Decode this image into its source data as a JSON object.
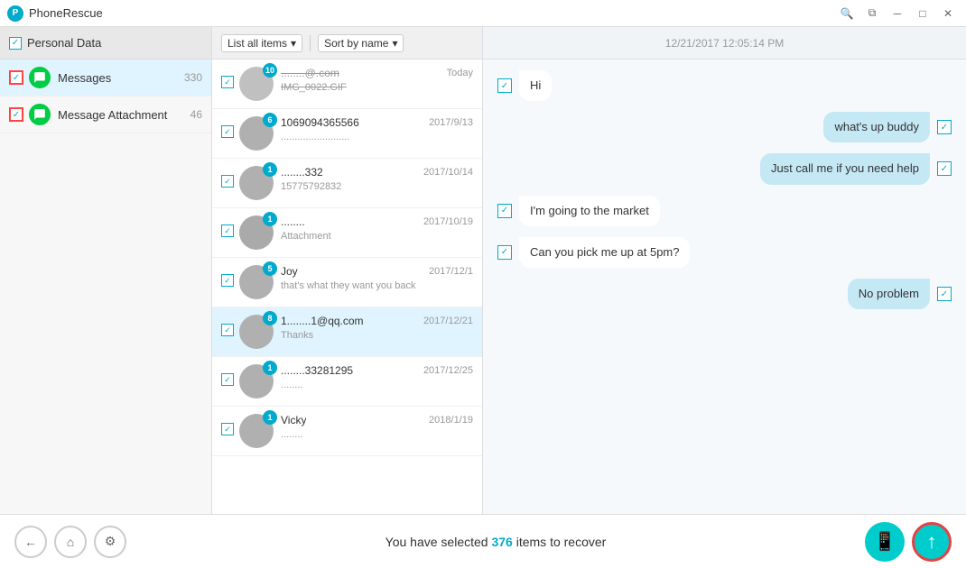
{
  "titlebar": {
    "logo": "P",
    "title": "PhoneRescue",
    "controls": [
      "search",
      "restore",
      "minimize",
      "maximize",
      "close"
    ]
  },
  "sidebar": {
    "header": {
      "label": "Personal Data",
      "checked": true
    },
    "items": [
      {
        "id": "messages",
        "label": "Messages",
        "count": "330",
        "checked": true
      },
      {
        "id": "message-attachment",
        "label": "Message Attachment",
        "count": "46",
        "checked": true
      }
    ]
  },
  "message_list": {
    "filter_label": "List all items",
    "sort_label": "Sort by name",
    "items": [
      {
        "badge": "10",
        "name": "........@.com",
        "date": "Today",
        "preview": "IMG_0022.GIF",
        "preview_strikethrough": true,
        "checked": true
      },
      {
        "badge": "6",
        "name": "1069094365566",
        "date": "2017/9/13",
        "preview": ".........................",
        "preview_strikethrough": false,
        "checked": true
      },
      {
        "badge": "1",
        "name": "........332",
        "date": "2017/10/14",
        "preview": "15775792832",
        "preview_strikethrough": false,
        "checked": true
      },
      {
        "badge": "1",
        "name": "........",
        "date": "2017/10/19",
        "preview": "Attachment",
        "preview_strikethrough": false,
        "checked": true
      },
      {
        "badge": "5",
        "name": "Joy",
        "date": "2017/12/1",
        "preview": "that's what they want you back",
        "preview_strikethrough": false,
        "checked": true
      },
      {
        "badge": "8",
        "name": "1........1@qq.com",
        "date": "2017/12/21",
        "preview": "Thanks",
        "preview_strikethrough": false,
        "checked": true,
        "active": true
      },
      {
        "badge": "1",
        "name": "........33281295",
        "date": "2017/12/25",
        "preview": "........",
        "preview_strikethrough": false,
        "checked": true
      },
      {
        "badge": "1",
        "name": "Vicky",
        "date": "2018/1/19",
        "preview": "........",
        "preview_strikethrough": false,
        "checked": true
      }
    ]
  },
  "chat": {
    "timestamp": "12/21/2017 12:05:14 PM",
    "messages": [
      {
        "side": "left",
        "text": "Hi",
        "checked": true
      },
      {
        "side": "right",
        "text": "what's up buddy",
        "checked": true
      },
      {
        "side": "right",
        "text": "Just call me if you need help",
        "checked": true
      },
      {
        "side": "left",
        "text": "I'm going to the market",
        "checked": true
      },
      {
        "side": "left",
        "text": "Can you pick me up at 5pm?",
        "checked": true
      },
      {
        "side": "right",
        "text": "No problem",
        "checked": true
      }
    ]
  },
  "bottom_bar": {
    "status_text": "You have selected",
    "count": "376",
    "status_suffix": "items to recover"
  },
  "nav_buttons": [
    {
      "label": "←",
      "id": "back"
    },
    {
      "label": "⌂",
      "id": "home"
    },
    {
      "label": "⚙",
      "id": "settings"
    }
  ],
  "action_buttons": [
    {
      "id": "restore-device",
      "icon": "📱"
    },
    {
      "id": "export",
      "icon": "↑"
    }
  ]
}
